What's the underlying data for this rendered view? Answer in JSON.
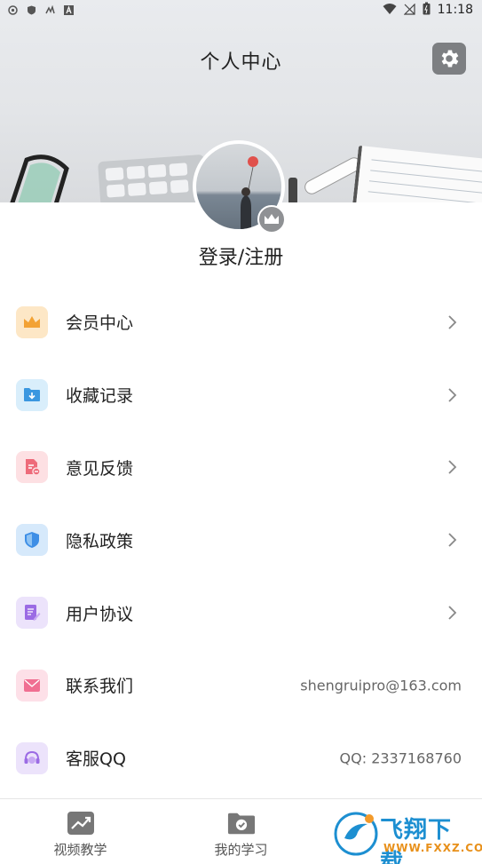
{
  "status_bar": {
    "time": "11:18",
    "left_icons": [
      "notification-icon",
      "shield-icon",
      "app-icon",
      "a-icon"
    ],
    "right_icons": [
      "wifi-icon",
      "signal-icon",
      "battery-icon"
    ]
  },
  "header": {
    "title": "个人中心",
    "settings_icon": "gear-icon"
  },
  "profile": {
    "login_text": "登录/注册",
    "badge_icon": "crown-icon"
  },
  "menu": {
    "items": [
      {
        "label": "会员中心",
        "icon": "crown-icon",
        "color": "#fde7c6",
        "accent": "#f3a234",
        "value": ""
      },
      {
        "label": "收藏记录",
        "icon": "folder-icon",
        "color": "#d9eefb",
        "accent": "#3a97e0",
        "value": ""
      },
      {
        "label": "意见反馈",
        "icon": "feedback-icon",
        "color": "#fde0e3",
        "accent": "#ee6b7a",
        "value": ""
      },
      {
        "label": "隐私政策",
        "icon": "shield-icon",
        "color": "#d6e9fb",
        "accent": "#3d8ee6",
        "value": ""
      },
      {
        "label": "用户协议",
        "icon": "document-edit-icon",
        "color": "#ece3fb",
        "accent": "#9b6be4",
        "value": ""
      },
      {
        "label": "联系我们",
        "icon": "mail-icon",
        "color": "#fde0e8",
        "accent": "#f06f92",
        "value": "shengruipro@163.com"
      },
      {
        "label": "客服QQ",
        "icon": "headset-icon",
        "color": "#ece3fb",
        "accent": "#9b6be4",
        "value": "QQ: 2337168760"
      }
    ]
  },
  "tabbar": {
    "tabs": [
      {
        "label": "视频教学",
        "icon": "trend-chart-icon"
      },
      {
        "label": "我的学习",
        "icon": "folder-check-icon"
      }
    ]
  },
  "watermark": {
    "logo_text": "飞翔下载",
    "sub_text": "WWW.FXXZ.COM"
  }
}
